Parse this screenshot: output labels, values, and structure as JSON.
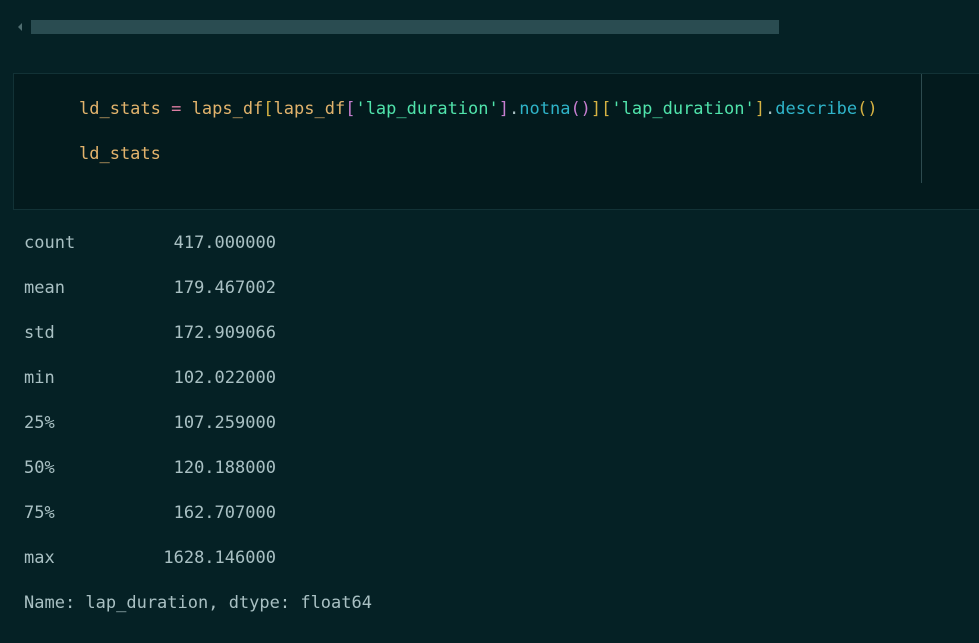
{
  "code_cell": {
    "line1_tokens": [
      "ld_stats",
      " ",
      "=",
      " ",
      "laps_df",
      "[",
      "laps_df",
      "[",
      "'lap_duration'",
      "]",
      ".",
      "notna",
      "()",
      "]",
      "[",
      "'lap_duration'",
      "]",
      ".",
      "describe",
      "()"
    ],
    "line2": "ld_stats"
  },
  "output": {
    "rows": [
      {
        "label": "count",
        "value": "417.000000"
      },
      {
        "label": "mean",
        "value": "179.467002"
      },
      {
        "label": "std",
        "value": "172.909066"
      },
      {
        "label": "min",
        "value": "102.022000"
      },
      {
        "label": "25%",
        "value": "107.259000"
      },
      {
        "label": "50%",
        "value": "120.188000"
      },
      {
        "label": "75%",
        "value": "162.707000"
      },
      {
        "label": "max",
        "value": "1628.146000"
      }
    ],
    "footer": "Name: lap_duration, dtype: float64"
  },
  "colors": {
    "background": "#052125",
    "cell_background": "#031a1d",
    "variable": "#e2b36c",
    "string": "#50e3ab",
    "method": "#2fb4c9",
    "operator": "#dc7ea2",
    "output_text": "#a9c0c3"
  }
}
